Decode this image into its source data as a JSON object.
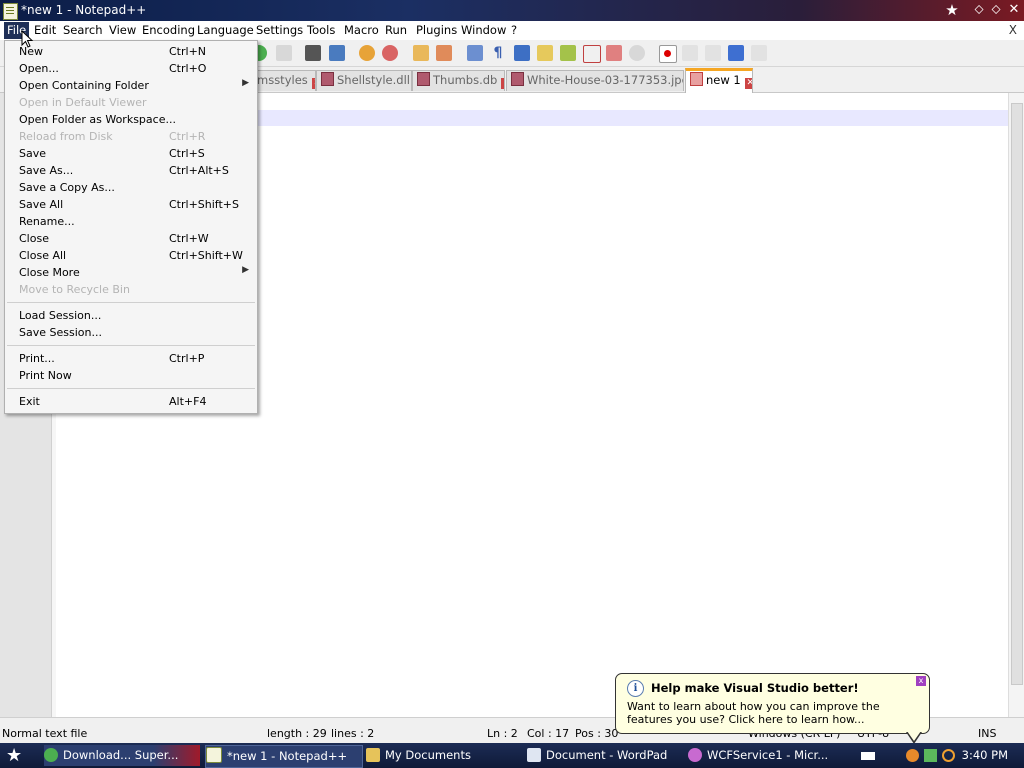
{
  "window": {
    "title": "*new 1 - Notepad++"
  },
  "menubar": {
    "items": [
      "File",
      "Edit",
      "Search",
      "View",
      "Encoding",
      "Language",
      "Settings",
      "Tools",
      "Macro",
      "Run",
      "Plugins",
      "Window",
      "?"
    ],
    "close": "X"
  },
  "tabs": [
    {
      "label": "msstyles",
      "active": false
    },
    {
      "label": "Shellstyle.dll",
      "active": false
    },
    {
      "label": "Thumbs.db",
      "active": false
    },
    {
      "label": "White-House-03-177353.jpeg",
      "active": false
    },
    {
      "label": "new 1",
      "active": true
    }
  ],
  "file_menu": {
    "items": [
      {
        "label": "New",
        "shortcut": "Ctrl+N",
        "disabled": false
      },
      {
        "label": "Open...",
        "shortcut": "Ctrl+O",
        "disabled": false
      },
      {
        "label": "Open Containing Folder",
        "shortcut": "",
        "submenu": true,
        "disabled": false
      },
      {
        "label": "Open in Default Viewer",
        "shortcut": "",
        "disabled": true
      },
      {
        "label": "Open Folder as Workspace...",
        "shortcut": "",
        "disabled": false
      },
      {
        "label": "Reload from Disk",
        "shortcut": "Ctrl+R",
        "disabled": true
      },
      {
        "label": "Save",
        "shortcut": "Ctrl+S",
        "disabled": false
      },
      {
        "label": "Save As...",
        "shortcut": "Ctrl+Alt+S",
        "disabled": false
      },
      {
        "label": "Save a Copy As...",
        "shortcut": "",
        "disabled": false
      },
      {
        "label": "Save All",
        "shortcut": "Ctrl+Shift+S",
        "disabled": false
      },
      {
        "label": "Rename...",
        "shortcut": "",
        "disabled": false
      },
      {
        "label": "Close",
        "shortcut": "Ctrl+W",
        "disabled": false
      },
      {
        "label": "Close All",
        "shortcut": "Ctrl+Shift+W",
        "disabled": false
      },
      {
        "label": "Close More",
        "shortcut": "",
        "submenu": true,
        "disabled": false
      },
      {
        "label": "Move to Recycle Bin",
        "shortcut": "",
        "disabled": true
      },
      {
        "label": "Load Session...",
        "shortcut": "",
        "disabled": false
      },
      {
        "label": "Save Session...",
        "shortcut": "",
        "disabled": false
      },
      {
        "label": "Print...",
        "shortcut": "Ctrl+P",
        "disabled": false
      },
      {
        "label": "Print Now",
        "shortcut": "",
        "disabled": false
      },
      {
        "label": "Exit",
        "shortcut": "Alt+F4",
        "disabled": false
      }
    ]
  },
  "statusbar": {
    "file_type": "Normal text file",
    "length": "length : 29",
    "lines": "lines : 2",
    "ln": "Ln : 2",
    "col": "Col : 17",
    "pos": "Pos : 30",
    "eol": "Windows (CR LF)",
    "encoding": "UTF-8",
    "mode": "INS"
  },
  "balloon": {
    "title": "Help make Visual Studio better!",
    "body": "Want to learn about how you can improve the features you use? Click here to learn how...",
    "close": "x"
  },
  "taskbar": {
    "tasks": [
      {
        "label": "Download... Super...",
        "active": false
      },
      {
        "label": "*new 1 - Notepad++",
        "active": true
      },
      {
        "label": "My Documents",
        "active": false
      },
      {
        "label": "Document - WordPad",
        "active": false
      },
      {
        "label": "WCFService1 - Micr...",
        "active": false
      }
    ],
    "clock": "3:40 PM"
  },
  "colors": {
    "title_bar": "#1b2f63",
    "active_tab_accent": "#f5a623",
    "menu_highlight": "#1e2f57"
  }
}
